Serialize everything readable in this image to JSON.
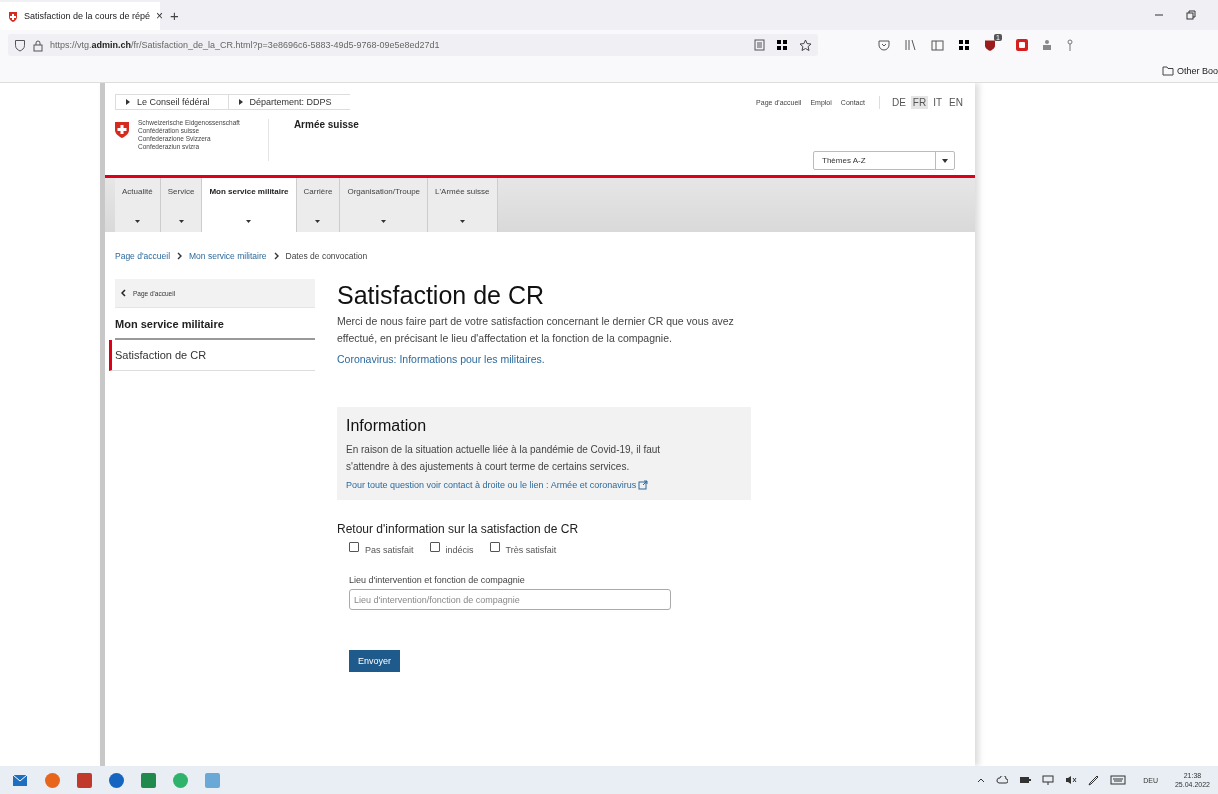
{
  "browser": {
    "tab": {
      "title": "Satisfaction de la cours de répé",
      "close": "×"
    },
    "new_tab": "+",
    "address": {
      "prefix": "https://vtg.",
      "domain": "admin.ch",
      "path": "/fr/Satisfaction_de_la_CR.html?p=3e8696c6-5883-49d5-9768-09e5e8ed27d1"
    },
    "extension_badge": "1",
    "bookmarks": [
      "Other Boo"
    ]
  },
  "page": {
    "federal_links": [
      "Le Conseil fédéral",
      "Département: DDPS"
    ],
    "service_links": [
      "Page d'accueil",
      "Emploi",
      "Contact"
    ],
    "languages": [
      {
        "code": "DE",
        "selected": false
      },
      {
        "code": "FR",
        "selected": true
      },
      {
        "code": "IT",
        "selected": false
      },
      {
        "code": "EN",
        "selected": false
      }
    ],
    "confederation_names": [
      "Schweizerische Eidgenossenschaft",
      "Confédération suisse",
      "Confederazione Svizzera",
      "Confederaziun svizra"
    ],
    "site_name": "Armée suisse",
    "topics_select": "Thèmes A-Z",
    "nav": [
      {
        "label": "Actualité",
        "selected": false
      },
      {
        "label": "Service",
        "selected": false
      },
      {
        "label": "Mon service militaire",
        "selected": true
      },
      {
        "label": "Carrière",
        "selected": false
      },
      {
        "label": "Organisation/Troupe",
        "selected": false
      },
      {
        "label": "L'Armée suisse",
        "selected": false
      }
    ],
    "breadcrumb": [
      {
        "label": "Page d'accueil",
        "kind": "link"
      },
      {
        "label": "Mon service militaire",
        "kind": "link"
      },
      {
        "label": "Dates de convocation",
        "kind": "current"
      }
    ],
    "sidebar": {
      "back": "Page d'accueil",
      "section": "Mon service militaire",
      "items": [
        {
          "label": "Satisfaction de CR",
          "selected": true
        }
      ]
    },
    "title": "Satisfaction de CR",
    "intro": "Merci de nous faire part de votre satisfaction concernant le dernier CR que vous avez effectué, en précisant le lieu d'affectation et la fonction de la compagnie.",
    "corona_link": "Coronavirus: Informations pour les militaires.",
    "info_box": {
      "title": "Information",
      "text": "En raison de la situation actuelle liée à la pandémie de Covid-19, il faut s'attendre à des ajustements à court terme de certains services.",
      "link": "Pour toute question voir contact à droite ou le lien : Armée et coronavirus"
    },
    "form": {
      "question": "Retour d'information sur la satisfaction de CR",
      "options": [
        {
          "label": "Pas satisfait",
          "checked": false
        },
        {
          "label": "indécis",
          "checked": false
        },
        {
          "label": "Très satisfait",
          "checked": false
        }
      ],
      "field_label": "Lieu d'intervention et fonction de compagnie",
      "field_placeholder": "Lieu d'intervention/fonction de compagnie",
      "submit": "Envoyer"
    }
  },
  "taskbar": {
    "apps": [
      {
        "color": "#1e6fc0"
      },
      {
        "color": "#e8661c"
      },
      {
        "color": "#c0392b"
      },
      {
        "color": "#1565c0"
      },
      {
        "color": "#1f8a4c"
      },
      {
        "color": "#2fb36b"
      },
      {
        "color": "#6aa8d8"
      }
    ],
    "language": "DEU",
    "time": "21:38",
    "date": "25.04.2022"
  }
}
